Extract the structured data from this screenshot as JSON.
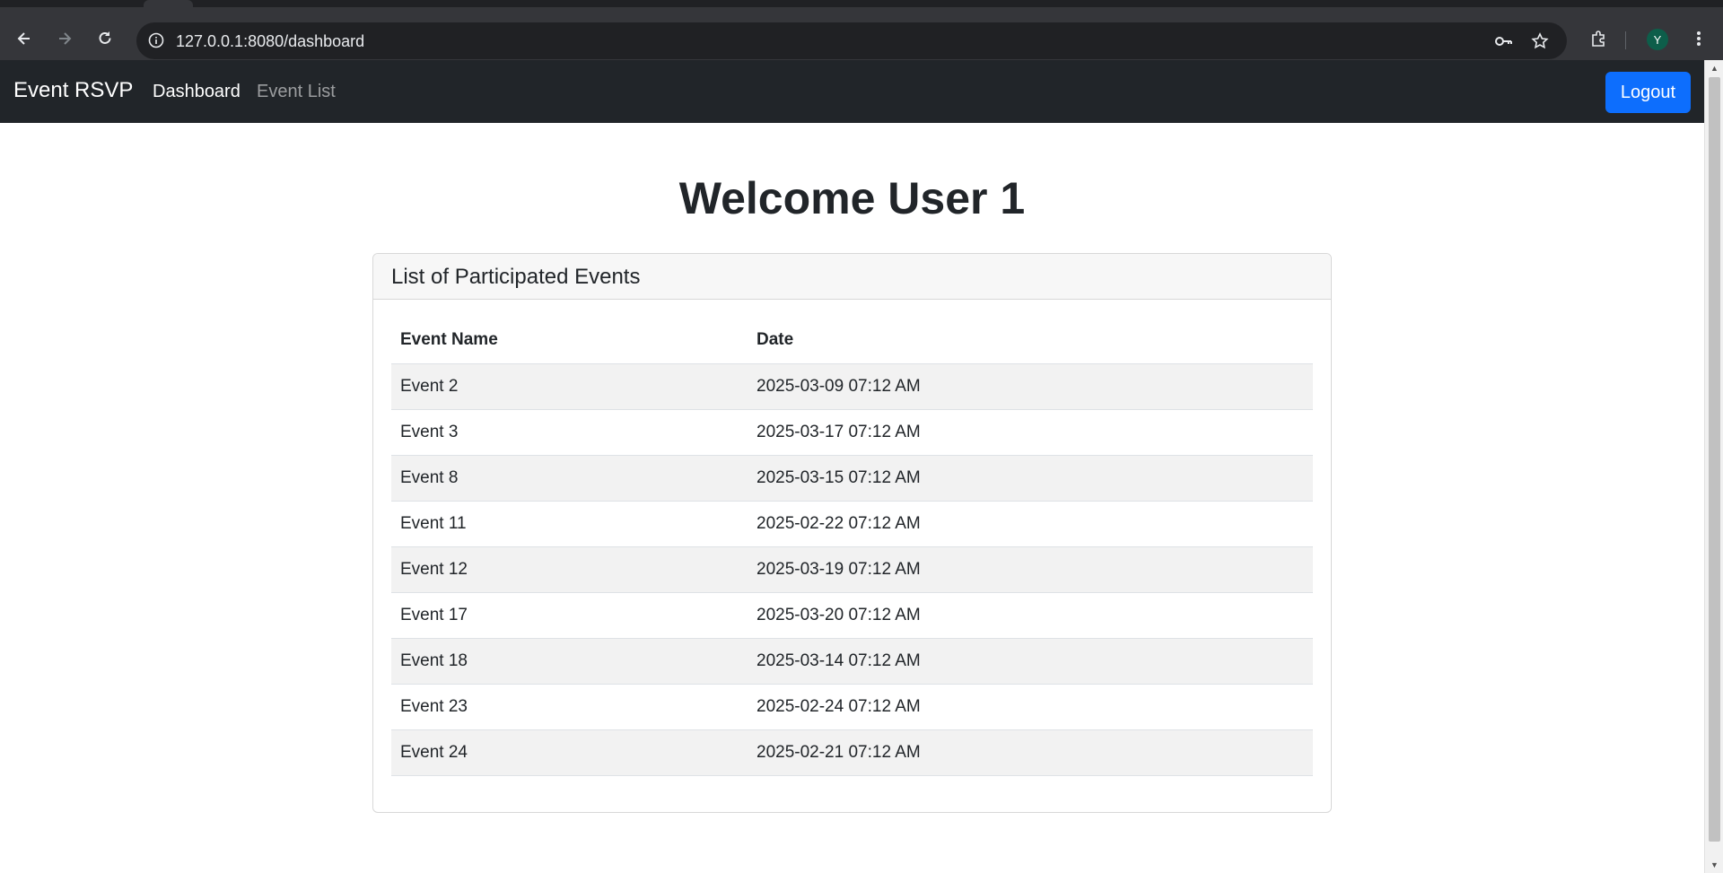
{
  "browser": {
    "url": "127.0.0.1:8080/dashboard",
    "profile_initial": "Y",
    "icons": [
      "back-icon",
      "forward-icon",
      "reload-icon",
      "site-info-icon",
      "key-icon",
      "star-icon",
      "extensions-icon",
      "menu-icon"
    ]
  },
  "navbar": {
    "brand": "Event RSVP",
    "links": [
      {
        "label": "Dashboard",
        "active": true
      },
      {
        "label": "Event List",
        "active": false
      }
    ],
    "logout_label": "Logout",
    "logout_color": "#0d6efd",
    "background": "#212529"
  },
  "main": {
    "heading": "Welcome User 1",
    "card": {
      "title": "List of Participated Events",
      "columns": [
        "Event Name",
        "Date"
      ],
      "rows": [
        [
          "Event 2",
          "2025-03-09 07:12 AM"
        ],
        [
          "Event 3",
          "2025-03-17 07:12 AM"
        ],
        [
          "Event 8",
          "2025-03-15 07:12 AM"
        ],
        [
          "Event 11",
          "2025-02-22 07:12 AM"
        ],
        [
          "Event 12",
          "2025-03-19 07:12 AM"
        ],
        [
          "Event 17",
          "2025-03-20 07:12 AM"
        ],
        [
          "Event 18",
          "2025-03-14 07:12 AM"
        ],
        [
          "Event 23",
          "2025-02-24 07:12 AM"
        ],
        [
          "Event 24",
          "2025-02-21 07:12 AM"
        ]
      ]
    }
  }
}
